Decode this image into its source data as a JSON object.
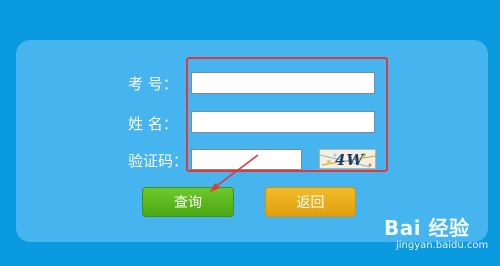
{
  "form": {
    "exam_number_label": "考  号：",
    "name_label": "姓  名：",
    "captcha_label": "验证码：",
    "exam_number_value": "",
    "name_value": "",
    "captcha_value": "",
    "captcha_image_text": "4W"
  },
  "buttons": {
    "query_label": "查询",
    "back_label": "返回"
  },
  "colors": {
    "page_bg": "#0a9ae0",
    "card_bg": "#46b4ee",
    "highlight": "#e0393a",
    "query_btn": "#5ab81e",
    "back_btn": "#e8ac18"
  },
  "watermark": {
    "brand": "Bai  经验",
    "url": "jingyan.baidu.com"
  }
}
